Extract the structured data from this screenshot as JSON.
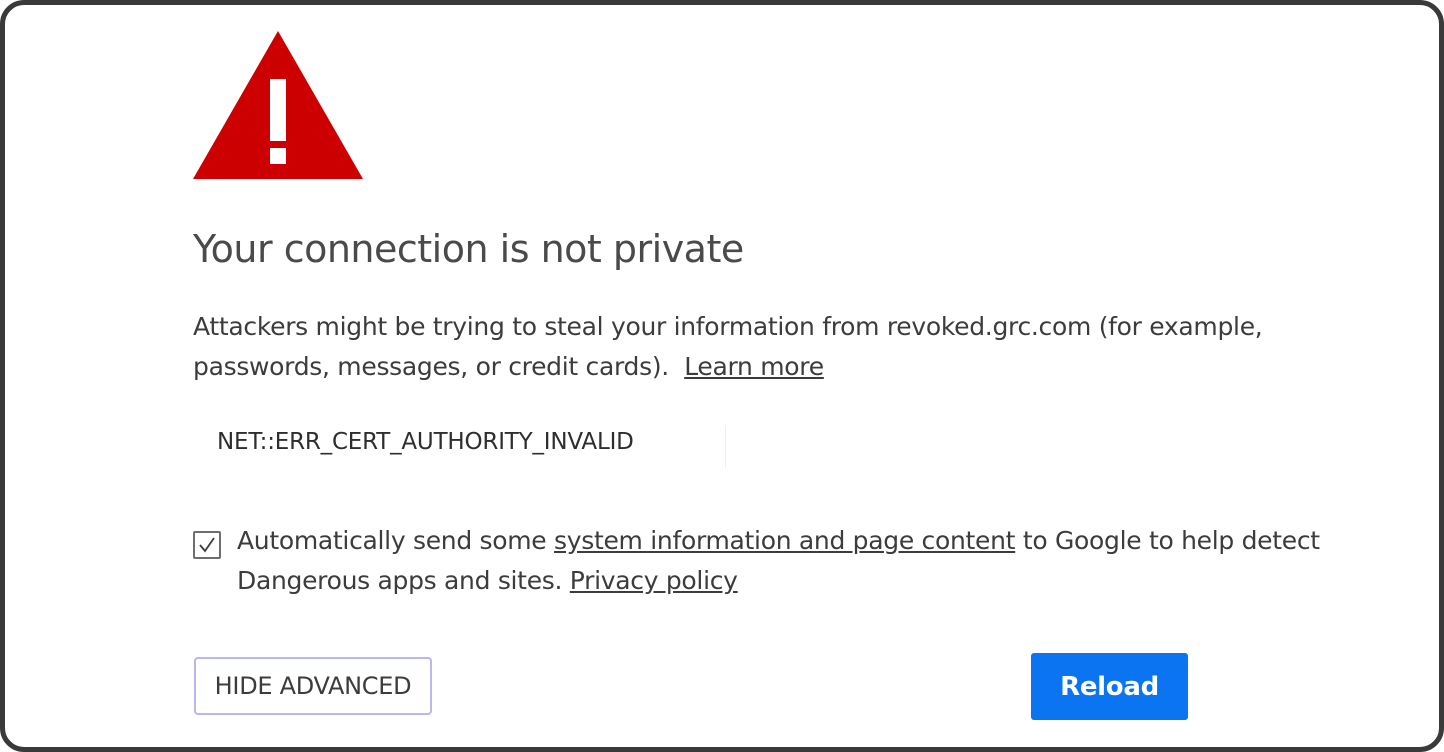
{
  "icons": {
    "warning": "warning-triangle-icon",
    "checkmark": "checkmark-icon"
  },
  "colors": {
    "warning_red": "#cc0000",
    "primary_button": "#0b74f0",
    "text": "#3c3c3c",
    "title": "#4a4a4a"
  },
  "interstitial": {
    "title": "Your connection is not private",
    "message_prefix": "Attackers might be trying to steal your information from ",
    "domain": "revoked.grc.com",
    "message_suffix": " (for example, passwords, messages, or credit cards).",
    "learn_more_label": "Learn more",
    "error_code": "NET::ERR_CERT_AUTHORITY_INVALID"
  },
  "opt_in": {
    "checked": true,
    "text_prefix": "Automatically send some ",
    "link_label": "system information and page content",
    "text_middle": " to Google to help detect Dangerous apps and sites. ",
    "privacy_link_label": "Privacy policy"
  },
  "buttons": {
    "hide_advanced_label": "HIDE ADVANCED",
    "reload_label": "Reload"
  }
}
